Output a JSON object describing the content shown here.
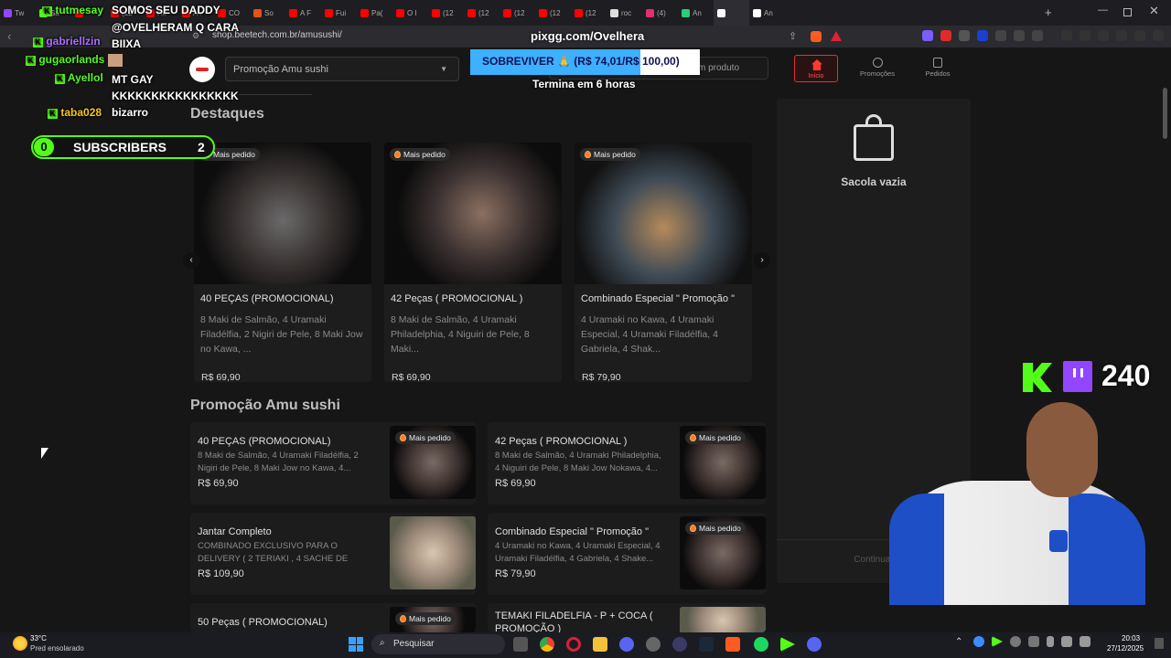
{
  "browser": {
    "tabs": [
      {
        "label": "Tw",
        "color": "#9146ff"
      },
      {
        "label": "Sa",
        "color": "#53fc18"
      },
      {
        "label": "",
        "color": "#ff0000"
      },
      {
        "label": "(12",
        "color": "#ff0000"
      },
      {
        "label": "He",
        "color": "#ff0000"
      },
      {
        "label": "A r",
        "color": "#ff0000"
      },
      {
        "label": "CO",
        "color": "#ff0000"
      },
      {
        "label": "So",
        "color": "#e5521a"
      },
      {
        "label": "A F",
        "color": "#ff0000"
      },
      {
        "label": "Fui",
        "color": "#ff0000"
      },
      {
        "label": "Pa(",
        "color": "#ff0000"
      },
      {
        "label": "O I",
        "color": "#ff0000"
      },
      {
        "label": "(12",
        "color": "#ff0000"
      },
      {
        "label": "(12",
        "color": "#ff0000"
      },
      {
        "label": "(12",
        "color": "#ff0000"
      },
      {
        "label": "(12",
        "color": "#ff0000"
      },
      {
        "label": "(12",
        "color": "#ff0000"
      },
      {
        "label": "roc",
        "color": "#dddddd"
      },
      {
        "label": "(4)",
        "color": "#e1306c"
      },
      {
        "label": "An",
        "color": "#2ecc71"
      },
      {
        "label": "",
        "color": "#ffffff",
        "active": true
      },
      {
        "label": "An",
        "color": "#ffffff"
      }
    ],
    "url": "shop.beetech.com.br/amusushi/"
  },
  "store": {
    "select_value": "Promoção Amu sushi",
    "search_placeholder": "m produto",
    "nav": {
      "home": "Início",
      "promos": "Promoções",
      "orders": "Pedidos"
    },
    "featured_title": "Destaques",
    "badge": "Mais pedido",
    "featured": [
      {
        "title": "40 PEÇAS (PROMOCIONAL)",
        "desc": "8 Maki de Salmão, 4 Uramaki Filadélfia, 2 Nigiri de Pele, 8 Maki Jow no Kawa, ...",
        "price": "R$ 69,90"
      },
      {
        "title": "42 Peças ( PROMOCIONAL )",
        "desc": "8 Maki de Salmão, 4 Uramaki Philadelphia, 4 Niguiri de Pele, 8 Maki...",
        "price": "R$ 69,90"
      },
      {
        "title": "Combinado Especial \" Promoção \"",
        "desc": "4 Uramaki no Kawa, 4 Uramaki Especial, 4 Uramaki Filadélfia, 4 Gabriela, 4 Shak...",
        "price": "R$ 79,90"
      }
    ],
    "promo_title": "Promoção Amu sushi",
    "items": [
      {
        "title": "40 PEÇAS (PROMOCIONAL)",
        "desc": "8 Maki de Salmão, 4 Uramaki Filadélfia, 2 Nigiri de Pele, 8 Maki Jow no Kawa, 4...",
        "price": "R$ 69,90"
      },
      {
        "title": "42 Peças ( PROMOCIONAL )",
        "desc": "8 Maki de Salmão, 4 Uramaki Philadelphia, 4 Niguiri de Pele, 8 Maki Jow Nokawa, 4...",
        "price": "R$ 69,90"
      },
      {
        "title": "Jantar Completo",
        "desc": "COMBINADO EXCLUSIVO PARA O DELIVERY ( 2 TERIAKI , 4 SACHE DE SHOYU ,1 SACHE...",
        "price": "R$ 109,90"
      },
      {
        "title": "Combinado Especial \" Promoção \"",
        "desc": "4 Uramaki no Kawa, 4 Uramaki Especial, 4 Uramaki Filadélfia, 4 Gabriela, 4 Shake...",
        "price": "R$ 79,90"
      },
      {
        "title": "50 Peças ( PROMOCIONAL)",
        "desc": "",
        "price": ""
      },
      {
        "title": "TEMAKI FILADELFIA - P + COCA ( PROMOÇÃO )",
        "desc": "",
        "price": ""
      }
    ],
    "cart_empty": "Sacola vazia",
    "continue": "Continuar"
  },
  "overlay": {
    "pix_url": "pixgg.com/Ovelhera",
    "goal_text": "SOBREVIVER 🙏 (R$ 74,01/R$ 100,00)",
    "goal_progress": 0.7401,
    "ends": "Termina em 6 horas",
    "chat": [
      {
        "user": "tutmesay",
        "msg": "SOMOS SEU DADDY @OVELHERAM Q CARA BIIXA",
        "color": "#53fc18"
      },
      {
        "user": "gabriellzin",
        "msg": "",
        "color": "#a970ff"
      },
      {
        "user": "gugaorlands",
        "msg": "",
        "color": "#53fc18"
      },
      {
        "user": "Ayellol",
        "msg": "MT GAY KKKKKKKKKKKKKKKK",
        "color": "#53fc18"
      },
      {
        "user": "taba028",
        "msg": "bizarro",
        "color": "#f5c518"
      }
    ],
    "subscribers_label": "SUBSCRIBERS",
    "subs_left": "0",
    "subs_right": "2",
    "viewers": "240"
  },
  "taskbar": {
    "weather_temp": "33°C",
    "weather_desc": "Pred ensolarado",
    "search": "Pesquisar",
    "time": "20:03",
    "date": "27/12/2025"
  }
}
